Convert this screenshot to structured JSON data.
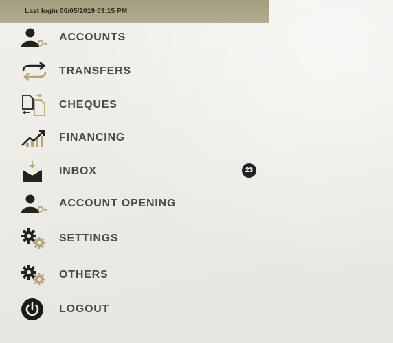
{
  "header": {
    "last_login": "Last login 06/05/2019 03:15 PM"
  },
  "menu": {
    "items": [
      {
        "label": "ACCOUNTS",
        "icon": "user-key-icon"
      },
      {
        "label": "TRANSFERS",
        "icon": "transfer-arrows-icon"
      },
      {
        "label": "CHEQUES",
        "icon": "cheques-icon"
      },
      {
        "label": "FINANCING",
        "icon": "financing-chart-icon"
      },
      {
        "label": "INBOX",
        "icon": "inbox-icon"
      },
      {
        "label": "ACCOUNT OPENING",
        "icon": "user-key-icon"
      },
      {
        "label": "SETTINGS",
        "icon": "gears-icon"
      },
      {
        "label": "OTHERS",
        "icon": "gears-icon"
      },
      {
        "label": "LOGOUT",
        "icon": "power-icon"
      }
    ],
    "inbox_badge": "23"
  },
  "colors": {
    "header_bg": "#a29d7e",
    "icon_dark": "#222222",
    "icon_accent": "#b5a57a",
    "label": "#4a4a48"
  }
}
